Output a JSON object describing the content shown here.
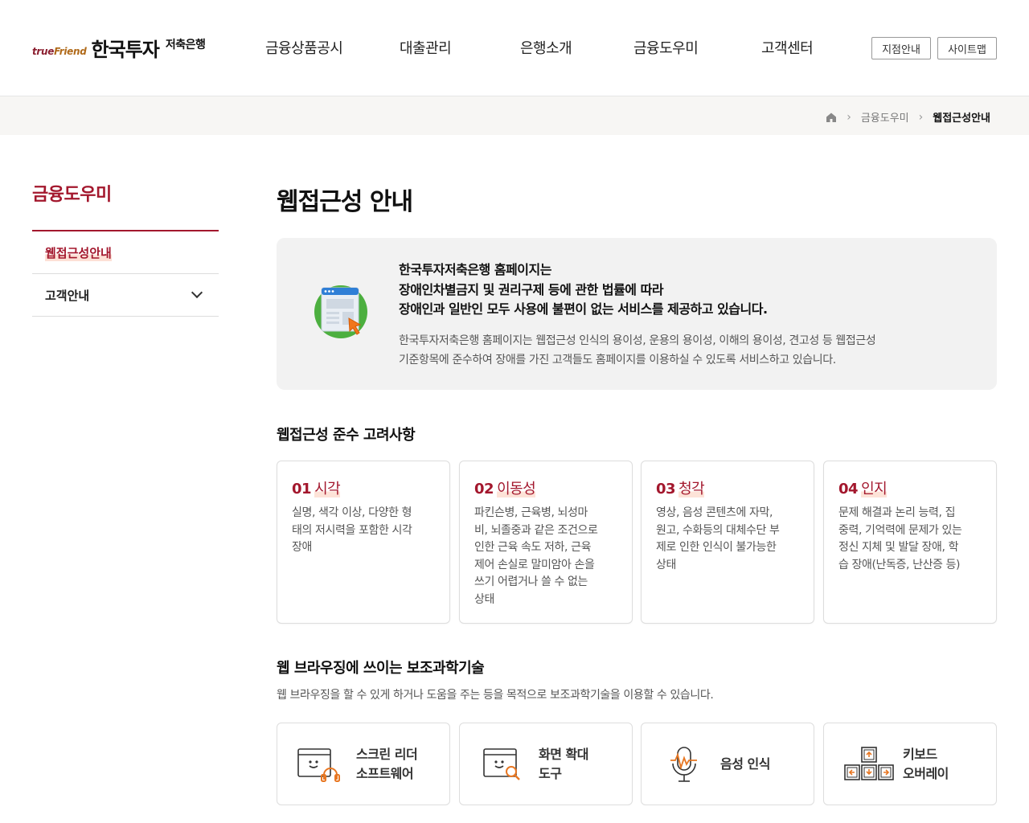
{
  "header": {
    "logo": {
      "brand": "trueFriend",
      "brand_part1": "true",
      "brand_part2": "Friend",
      "name": "한국투자",
      "sub": "저축은행"
    },
    "gnb": [
      "금융상품공시",
      "대출관리",
      "은행소개",
      "금융도우미",
      "고객센터"
    ],
    "buttons": {
      "branch": "지점안내",
      "sitemap": "사이트맵"
    }
  },
  "breadcrumb": {
    "home_icon": "home-icon",
    "items": [
      "금융도우미",
      "웹접근성안내"
    ]
  },
  "sidebar": {
    "title": "금융도우미",
    "items": [
      {
        "label": "웹접근성안내",
        "active": true
      },
      {
        "label": "고객안내",
        "active": false,
        "expandable": true
      }
    ]
  },
  "main": {
    "title": "웹접근성 안내",
    "intro": {
      "lead": [
        "한국투자저축은행 홈페이지는",
        "장애인차별금지 및 권리구제 등에 관한 법률에 따라",
        "장애인과 일반인 모두 사용에 불편이 없는 서비스를 제공하고 있습니다."
      ],
      "desc": [
        "한국투자저축은행 홈페이지는 웹접근성 인식의 용이성, 운용의 용이성, 이해의 용이성, 견고성 등 웹접근성",
        "기준항목에 준수하여 장애를 가진 고객들도 홈페이지를 이용하실 수 있도록 서비스하고 있습니다."
      ]
    },
    "considerations": {
      "title": "웹접근성 준수 고려사항",
      "cards": [
        {
          "num": "01",
          "title": "시각",
          "lines": [
            "실명, 색각 이상, 다양한 형",
            "태의 저시력을 포함한 시각",
            "장애"
          ]
        },
        {
          "num": "02",
          "title": "이동성",
          "lines": [
            "파킨슨병, 근육병, 뇌성마",
            "비, 뇌졸중과 같은 조건으로",
            "인한 근육 속도 저하, 근육",
            "제어 손실로 말미암아 손을",
            "쓰기 어렵거나 쓸 수 없는",
            "상태"
          ]
        },
        {
          "num": "03",
          "title": "청각",
          "lines": [
            "영상, 음성 콘텐츠에 자막,",
            "원고, 수화등의 대체수단 부",
            "제로 인한 인식이 불가능한",
            "상태"
          ]
        },
        {
          "num": "04",
          "title": "인지",
          "lines": [
            "문제 해결과 논리 능력, 집",
            "중력, 기억력에 문제가 있는",
            "정신 지체 및 발달 장애, 학",
            "습 장애(난독증, 난산증 등)"
          ]
        }
      ]
    },
    "assistive": {
      "title": "웹 브라우징에 쓰이는 보조과학기술",
      "desc": "웹 브라우징을 할 수 있게 하거나 도움을 주는 등을 목적으로 보조과학기술을 이용할 수 있습니다.",
      "items": [
        {
          "icon": "screen-reader-icon",
          "lines": [
            "스크린 리더",
            "소프트웨어"
          ]
        },
        {
          "icon": "magnifier-icon",
          "lines": [
            "화면 확대",
            "도구"
          ]
        },
        {
          "icon": "microphone-icon",
          "lines": [
            "음성 인식"
          ]
        },
        {
          "icon": "keyboard-icon",
          "lines": [
            "키보드",
            "오버레이"
          ]
        }
      ]
    }
  },
  "colors": {
    "accent": "#a3172d",
    "highlight": "#fde0d6",
    "panel": "#f2f2f2",
    "crumbbar": "#f7f6f4"
  }
}
